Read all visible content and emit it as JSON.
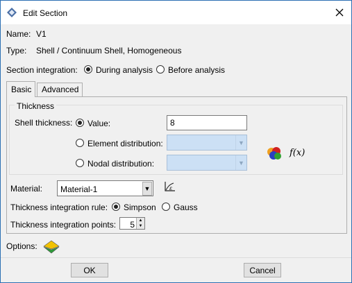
{
  "window": {
    "title": "Edit Section",
    "icon": "abaqus-app-icon"
  },
  "info": {
    "name_label": "Name:",
    "name_value": "V1",
    "type_label": "Type:",
    "type_value": "Shell / Continuum Shell, Homogeneous"
  },
  "integration": {
    "label": "Section integration:",
    "options": [
      "During analysis",
      "Before analysis"
    ],
    "selected": "During analysis"
  },
  "tabs": [
    {
      "label": "Basic",
      "active": true
    },
    {
      "label": "Advanced",
      "active": false
    }
  ],
  "thickness": {
    "group_title": "Thickness",
    "shell_label": "Shell thickness:",
    "value_label": "Value:",
    "value": "8",
    "element_label": "Element distribution:",
    "nodal_label": "Nodal distribution:",
    "fx_label": "f(x)"
  },
  "material": {
    "label": "Material:",
    "value": "Material-1"
  },
  "rule": {
    "label": "Thickness integration rule:",
    "options": [
      "Simpson",
      "Gauss"
    ],
    "selected": "Simpson"
  },
  "points": {
    "label": "Thickness integration points:",
    "value": "5"
  },
  "options": {
    "label": "Options:"
  },
  "buttons": {
    "ok": "OK",
    "cancel": "Cancel"
  },
  "icons": [
    "abaqus-app-icon",
    "close-icon",
    "analytical-field-icon",
    "material-manager-icon",
    "section-options-icon",
    "chevron-down-icon"
  ]
}
